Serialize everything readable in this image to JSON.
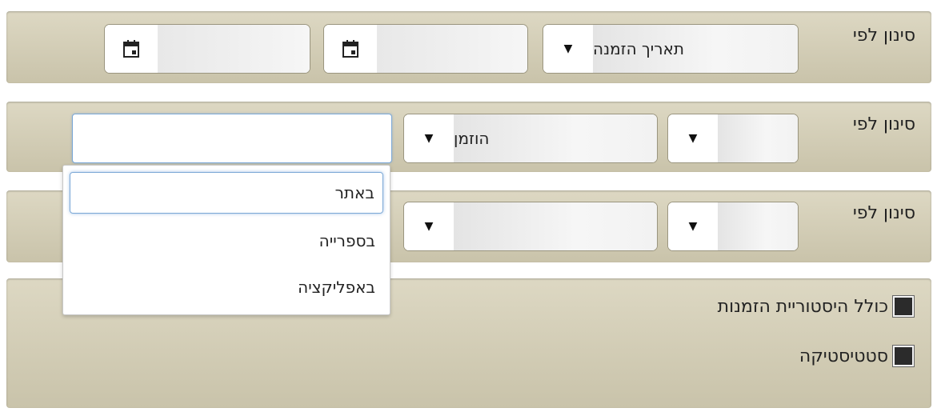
{
  "filters": {
    "row1": {
      "label": "סינון לפי",
      "select_value": "תאריך הזמנה"
    },
    "row2": {
      "label": "סינון לפי",
      "select1_value": "",
      "select2_value": "הוזמן",
      "text_value": ""
    },
    "row3": {
      "label": "סינון לפי",
      "select1_value": "",
      "select2_value": ""
    }
  },
  "dropdown": {
    "items": [
      {
        "label": "באתר",
        "highlighted": true
      },
      {
        "label": "בספרייה"
      },
      {
        "label": "באפליקציה"
      }
    ]
  },
  "checkboxes": {
    "include_history": "כולל היסטוריית הזמנות",
    "statistics": "סטטיסטיקה"
  },
  "icons": {
    "arrow": "▼"
  }
}
